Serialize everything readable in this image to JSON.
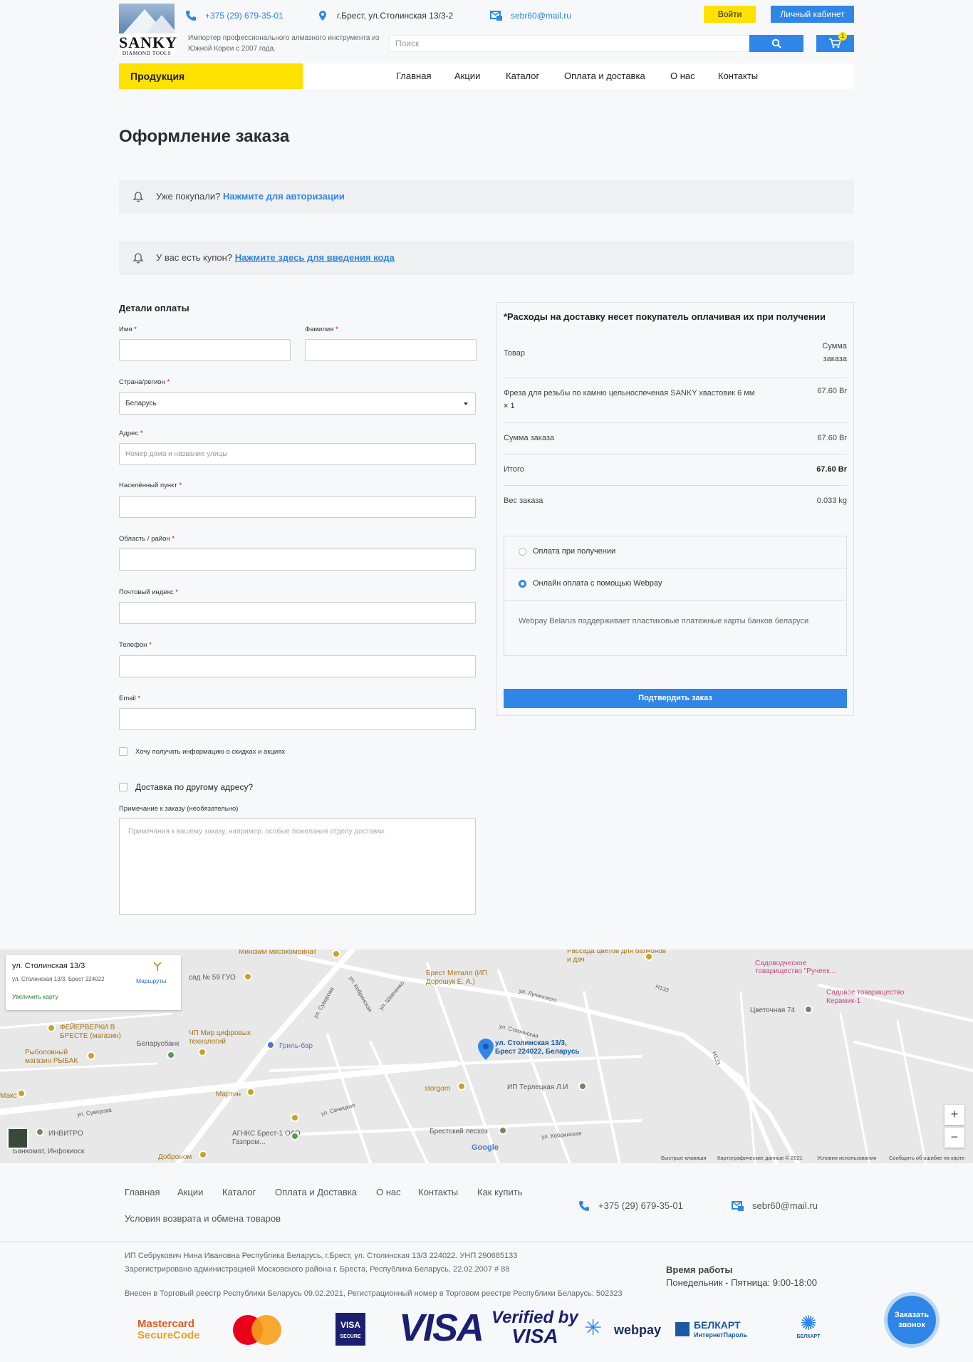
{
  "header": {
    "logo_title": "SANKY",
    "logo_sub": "DIAMOND TOOLS",
    "phone": "+375 (29) 679-35-01",
    "address": "г.Брест, ул.Столинская 13/3-2",
    "email": "sebr60@mail.ru",
    "tagline": "Импортер профессионального алмазного инструмента из Южной Кореи с 2007 года.",
    "login_label": "Войти",
    "cabinet_label": "Личный кабинет",
    "search_placeholder": "Поиск",
    "cart_count": "1",
    "products_label": "Продукция",
    "nav": [
      "Главная",
      "Акции",
      "Каталог",
      "Оплата и доставка",
      "О нас",
      "Контакты"
    ]
  },
  "page": {
    "title": "Оформление заказа",
    "notice_login_text": "Уже покупали?",
    "notice_login_link": "Нажмите для авторизации",
    "notice_coupon_text": "У вас есть купон?",
    "notice_coupon_link": "Нажмите здесь для введения кода"
  },
  "billing": {
    "title": "Детали оплаты",
    "first_name_label": "Имя",
    "last_name_label": "Фамилия",
    "country_label": "Страна/регион",
    "country_value": "Беларусь",
    "address_label": "Адрес",
    "address_placeholder": "Номер дома и название улицы",
    "city_label": "Населённый пункт",
    "region_label": "Область / район",
    "postcode_label": "Почтовый индекс",
    "phone_label": "Телефон",
    "email_label": "Email",
    "required_mark": "*",
    "newsletter_label": "Хочу получать информацию о скидках и акциях",
    "ship_other_label": "Доставка по другому адресу?",
    "notes_label": "Примечание к заказу (необязательно)",
    "notes_placeholder": "Примечания к вашему заказу, например, особые пожелания отделу доставки."
  },
  "order": {
    "title": "*Расходы на доставку несет покупатель оплачивая их при получении",
    "col_product": "Товар",
    "col_sum_1": "Сумма",
    "col_sum_2": "заказа",
    "item_name": "Фреза для резьбы по камню цельноспеченая SANKY хвастовик 6 мм",
    "item_qty": "× 1",
    "item_price": "67.60 Br",
    "subtotal_label": "Сумма заказа",
    "subtotal_value": "67.60 Br",
    "total_label": "Итого",
    "total_value": "67.60 Br",
    "weight_label": "Вес заказа",
    "weight_value": "0.033 kg",
    "pay_cod": "Оплата при получении",
    "pay_webpay": "Онлайн оплата с помощью Webpay",
    "pay_desc": "Webpay Belarus поддерживает пластиковые платежные карты банков беларуси",
    "confirm_label": "Подтвердить заказ"
  },
  "map": {
    "card_title": "ул. Столинская 13/3",
    "card_addr": "ул. Столинская 13/3, Брест 224022",
    "card_routes": "Маршруты",
    "card_enlarge": "Увеличить карту",
    "pin_label_1": "ул. Столинская 13/3,",
    "pin_label_2": "Брест 224022, Беларусь",
    "zoom_in": "+",
    "zoom_out": "−",
    "google": "Google",
    "foot_keys": "Быстрые клавиши",
    "foot_data": "Картографические данные © 2021",
    "foot_terms": "Условия использования",
    "foot_report": "Сообщить об ошибке на карте",
    "places": [
      "Минский мясокомбинат",
      "сад № 59 ГУО",
      "Брест Металл (ИП Дорошук Е. А.)",
      "Рассада цветов для балконов и дач",
      "Садоводческое товарищество \"Ручеек...",
      "Садовое товарищество Керамик-1",
      "Цветочная 74",
      "ФЕЙЕРВЕРКИ В БРЕСТЕ (магазин)",
      "ЧП Мир цифровых технологий",
      "Беларусбанк",
      "Рыболовный магазин РЫБАК",
      "Гриль-бар",
      "storgom",
      "ИП Терлецкая Л.И",
      "Мартин",
      "Макс",
      "АГНКС Брест-1 ОАО Газпром...",
      "Брестский лесхоз",
      "ИНВИТРО",
      "Банкомат, Инфокиоск",
      "Доброном"
    ],
    "streets": [
      "ул. Суворова",
      "ул. Кобринская",
      "ул. Шевченко",
      "ул. Лучинского",
      "ул. Столинская",
      "ул. Сеницкая",
      "ул. Суворова",
      "ул. Кобринская",
      "Н133",
      "Н133"
    ]
  },
  "footer": {
    "links_row1": [
      "Главная",
      "Акции",
      "Каталог",
      "Оплата и Доставка",
      "О нас",
      "Контакты",
      "Как купить"
    ],
    "links_row2": [
      "Условия возврата и обмена товаров"
    ],
    "phone": "+375 (29) 679-35-01",
    "email": "sebr60@mail.ru",
    "legal_1": "ИП Себрукович Нина Ивановна Республика Беларусь, г.Брест, ул. Столинская 13/3 224022. УНП 290685133",
    "legal_2": "Зарегистрировано администрацией Московского района г. Бреста, Республика Беларусь, 22.02.2007 # 88",
    "legal_3": "Внесен в Торговый реестр Республики Беларусь 09.02.2021, Регистрационный номер в Торговом реестре Республики Беларусь: 502323",
    "hours_title": "Время работы",
    "hours_value": "Понедельник - Пятница: 9:00-18:00",
    "logo_mc_1": "Mastercard",
    "logo_mc_2": "SecureCode",
    "logo_visa_secure_1": "VISA",
    "logo_visa_secure_2": "SECURE",
    "logo_visa": "VISA",
    "logo_vbv_1": "Verified by",
    "logo_vbv_2": "VISA",
    "logo_webpay": "webpay",
    "logo_belkart_1": "БЕЛКАРТ",
    "logo_belkart_2": "ИнтернетПароль",
    "logo_belkart_small": "БЕЛКАРТ",
    "callback_1": "Заказать",
    "callback_2": "звонок"
  },
  "colors": {
    "accent_blue": "#2f86e6",
    "accent_yellow": "#ffe100"
  }
}
